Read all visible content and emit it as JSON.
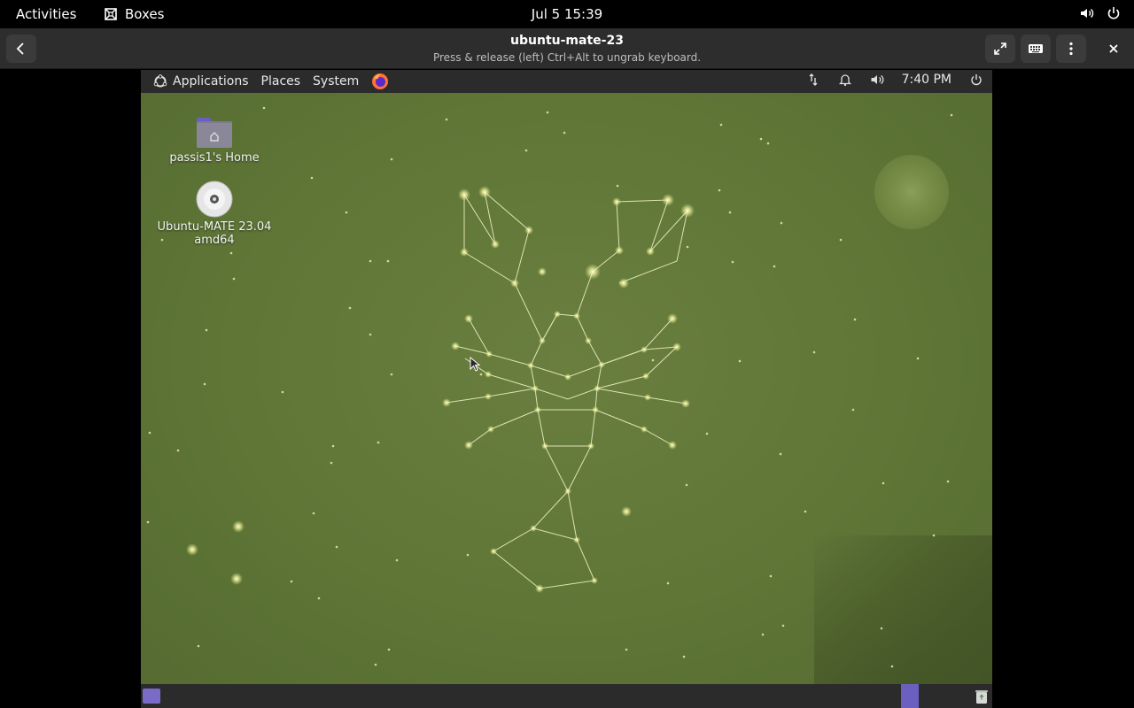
{
  "gnome": {
    "activities": "Activities",
    "app_name": "Boxes",
    "clock": "Jul 5  15:39",
    "tray_icons": [
      "volume-icon",
      "power-icon"
    ]
  },
  "boxes": {
    "title": "ubuntu-mate-23",
    "subtitle": "Press & release (left) Ctrl+Alt to ungrab keyboard.",
    "buttons": [
      "back-icon",
      "fullscreen-icon",
      "keyboard-icon",
      "menu-icon",
      "close-icon"
    ]
  },
  "mate": {
    "menu": {
      "applications": "Applications",
      "places": "Places",
      "system": "System"
    },
    "time": "7:40 PM",
    "tray_icons": [
      "network-icon",
      "notification-bell-icon",
      "volume-icon",
      "power-icon"
    ]
  },
  "desktop": {
    "icons": [
      {
        "label": "passis1's Home",
        "icon": "home-folder-icon"
      },
      {
        "label_line1": "Ubuntu-MATE 23.04",
        "label_line2": "amd64",
        "icon": "dvd-icon"
      }
    ]
  },
  "colors": {
    "desktop_bg": "#5f7637",
    "panel_bg": "#2b2b2b",
    "workspace_accent": "#6b5fbf"
  }
}
